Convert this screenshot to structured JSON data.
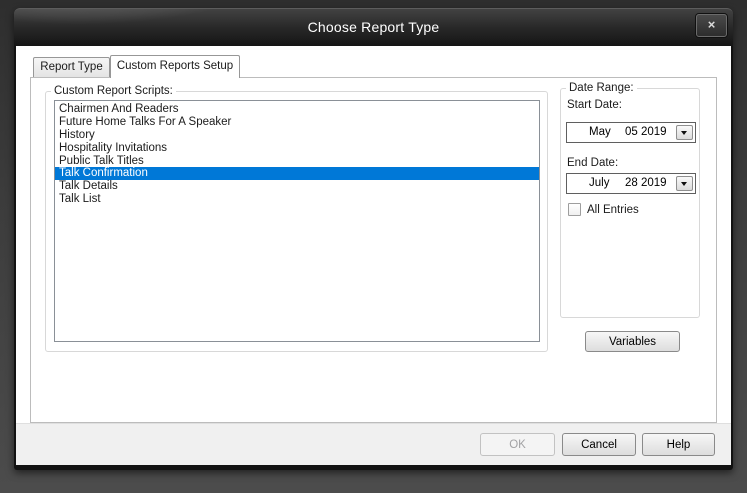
{
  "window": {
    "title": "Choose Report Type"
  },
  "icons": {
    "close": "×"
  },
  "tabs": [
    {
      "label": "Report Type",
      "active": false
    },
    {
      "label": "Custom Reports Setup",
      "active": true
    }
  ],
  "scripts_group": {
    "label": "Custom Report Scripts:",
    "selected_index": 5,
    "items": [
      "Chairmen And Readers",
      "Future Home Talks For A Speaker",
      "History",
      "Hospitality Invitations",
      "Public Talk Titles",
      "Talk Confirmation",
      "Talk Details",
      "Talk List"
    ]
  },
  "date_range": {
    "label": "Date Range:",
    "start_label": "Start Date:",
    "start": {
      "month": "May",
      "day_year": "05 2019"
    },
    "end_label": "End Date:",
    "end": {
      "month": "July",
      "day_year": "28 2019"
    },
    "all_entries_label": "All Entries",
    "all_entries_checked": false
  },
  "variables_button_label": "Variables",
  "footer": {
    "ok_label": "OK",
    "ok_enabled": false,
    "cancel_label": "Cancel",
    "help_label": "Help"
  },
  "colors": {
    "selection": "#0078d7",
    "titlebar_text": "#ffffff"
  }
}
